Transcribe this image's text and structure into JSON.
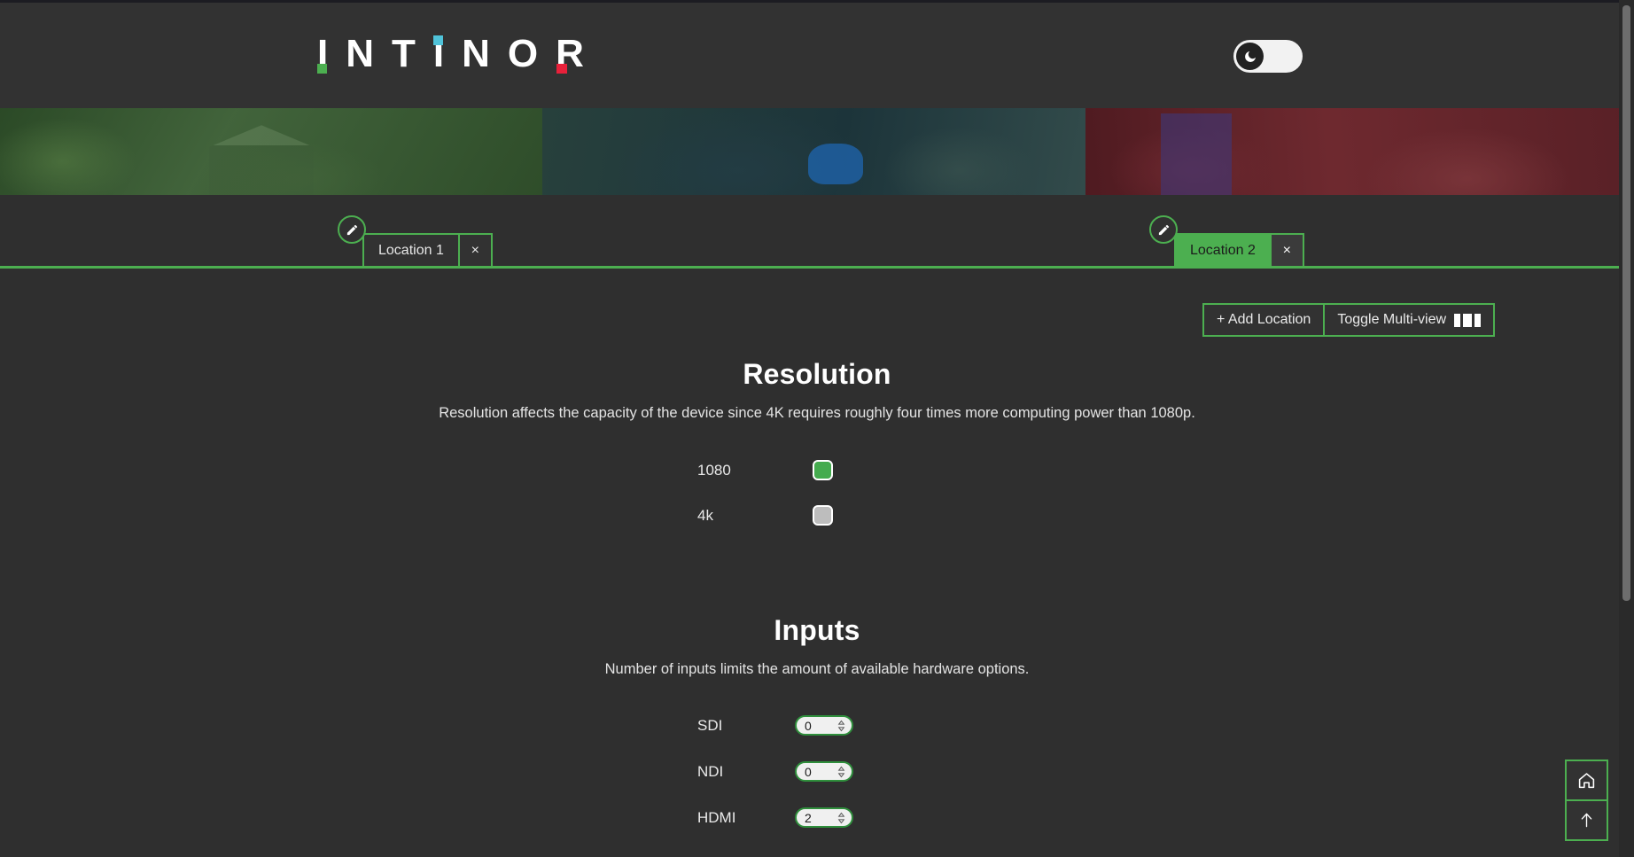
{
  "header": {
    "brand": "INTINOR",
    "brand_letters": [
      "I",
      "N",
      "T",
      "I",
      "N",
      "O",
      "R"
    ],
    "accent_green": "#4caf50",
    "accent_cyan": "#4fc3d9",
    "accent_red": "#e8203a",
    "theme_toggle": {
      "name": "dark-mode-toggle",
      "icon": "moon-icon",
      "state": "dark"
    }
  },
  "banner": {
    "segments": [
      {
        "name": "banner-image-green",
        "tint": "#3d5e3a"
      },
      {
        "name": "banner-image-teal",
        "tint": "#20383e"
      },
      {
        "name": "banner-image-red",
        "tint": "#5e2229"
      }
    ]
  },
  "tabs": {
    "items": [
      {
        "label": "Location 1",
        "active": false,
        "edit_icon": "pencil-icon",
        "close_label": "×"
      },
      {
        "label": "Location 2",
        "active": true,
        "edit_icon": "pencil-icon",
        "close_label": "×"
      }
    ]
  },
  "actions": {
    "add_location": "+ Add Location",
    "toggle_multiview": "Toggle Multi-view"
  },
  "sections": [
    {
      "id": "resolution",
      "title": "Resolution",
      "description": "Resolution affects the capacity of the device since 4K requires roughly four times more computing power than 1080p.",
      "options": [
        {
          "label": "1080",
          "selected": true
        },
        {
          "label": "4k",
          "selected": false
        }
      ]
    },
    {
      "id": "inputs",
      "title": "Inputs",
      "description": "Number of inputs limits the amount of available hardware options.",
      "fields": [
        {
          "label": "SDI",
          "value": "0"
        },
        {
          "label": "NDI",
          "value": "0"
        },
        {
          "label": "HDMI",
          "value": "2"
        }
      ]
    }
  ],
  "corner_buttons": [
    {
      "name": "home-button",
      "icon": "home-icon"
    },
    {
      "name": "scroll-top-button",
      "icon": "arrow-up-icon"
    }
  ]
}
